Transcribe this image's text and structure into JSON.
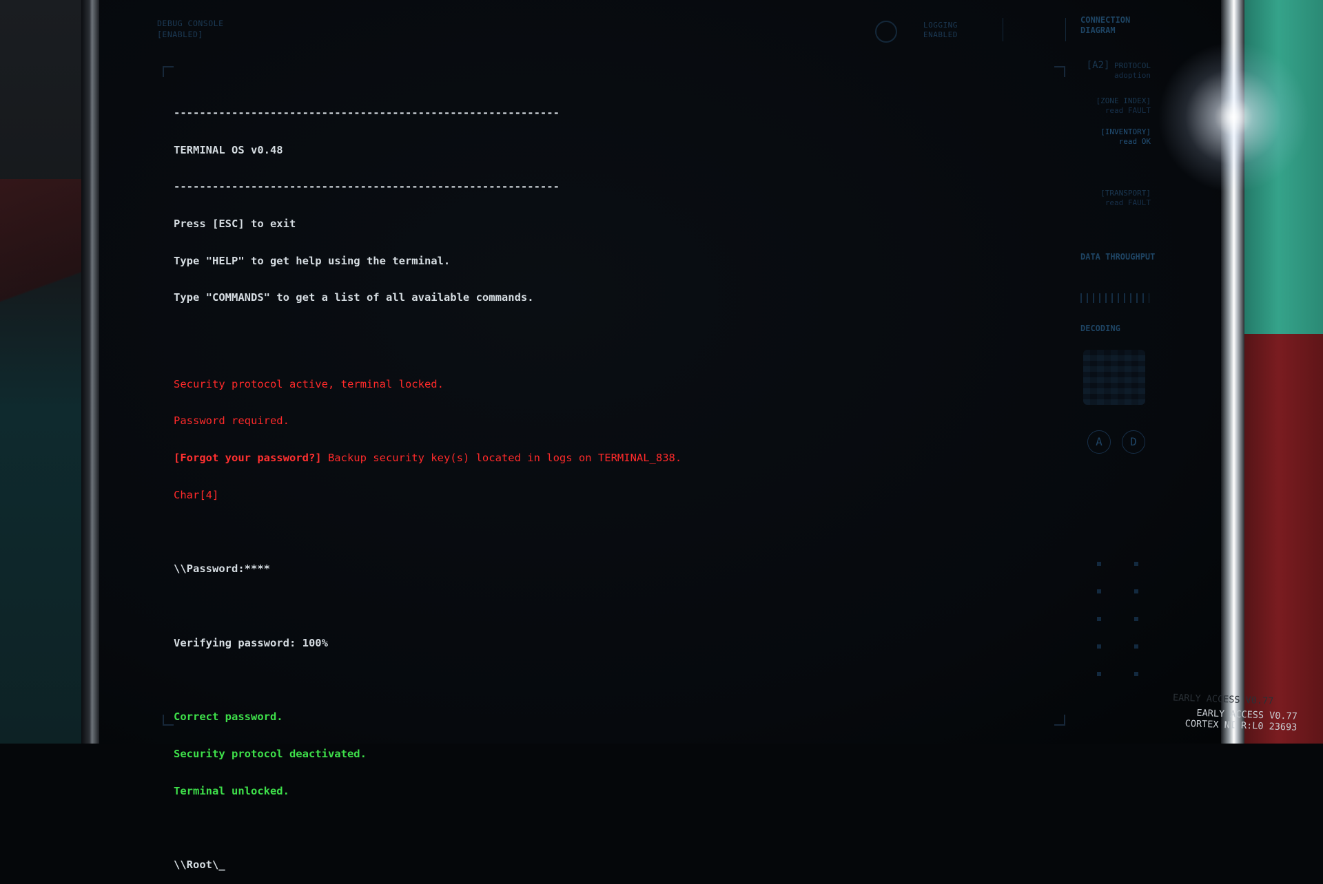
{
  "terminal": {
    "rule": "------------------------------------------------------------",
    "title": "TERMINAL OS v0.48",
    "help_lines": [
      "Press [ESC] to exit",
      "Type \"HELP\" to get help using the terminal.",
      "Type \"COMMANDS\" to get a list of all available commands."
    ],
    "lock_lines": [
      "Security protocol active, terminal locked.",
      "Password required."
    ],
    "forgot_label": "[Forgot your password?]",
    "forgot_text": " Backup security key(s) located in logs on TERMINAL_838.",
    "char_count": "Char[4]",
    "password_prompt": "\\\\Password:****",
    "verifying": "Verifying password: 100%",
    "success_lines": [
      "Correct password.",
      "Security protocol deactivated.",
      "Terminal unlocked."
    ],
    "root_prompt": "\\\\Root\\_"
  },
  "hud": {
    "debug_console": "DEBUG CONSOLE",
    "debug_state": "[ENABLED]",
    "logging": "LOGGING",
    "logging_state": "ENABLED"
  },
  "right_panel": {
    "connection_title": "CONNECTION DIAGRAM",
    "nodes": [
      {
        "code": "[A2]",
        "label": "PROTOCOL",
        "status": "adoption"
      },
      {
        "code": "",
        "label": "[ZONE INDEX]",
        "status": "read FAULT"
      },
      {
        "code": "",
        "label": "[INVENTORY]",
        "status": "read OK"
      },
      {
        "code": "",
        "label": "[TRANSPORT]",
        "status": "read FAULT"
      }
    ],
    "throughput_title": "DATA THROUGHPUT",
    "decoding_title": "DECODING",
    "buttons": [
      "A",
      "D"
    ]
  },
  "watermark": {
    "line1": "EARLY ACCESS V0.77",
    "line2": "CORTEX NI R:L0 23693"
  },
  "colors": {
    "white": "#d6dde2",
    "red": "#ff2a2a",
    "green": "#3ee04a"
  }
}
